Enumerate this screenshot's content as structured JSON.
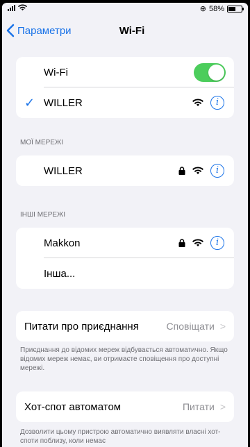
{
  "status_bar": {
    "battery_text": "58%",
    "battery_level": 0.58
  },
  "nav": {
    "back_label": "Параметри",
    "title": "Wi-Fi"
  },
  "wifi_group": {
    "toggle_label": "Wi-Fi",
    "toggle_on": true,
    "connected_network": "WILLER"
  },
  "my_networks": {
    "header": "МОЇ МЕРЕЖІ",
    "items": [
      {
        "name": "WILLER",
        "locked": true
      }
    ]
  },
  "other_networks": {
    "header": "ІНШІ МЕРЕЖІ",
    "items": [
      {
        "name": "Makkon",
        "locked": true
      }
    ],
    "other_label": "Інша..."
  },
  "ask_to_join": {
    "label": "Питати про приєднання",
    "value": "Сповіщати",
    "footnote": "Приєднання до відомих мереж відбувається автоматично. Якщо відомих мереж немає, ви отримаєте сповіщення про доступні мережі."
  },
  "auto_hotspot": {
    "label": "Хот-спот автоматом",
    "value": "Питати",
    "footnote": "Дозволити цьому пристрою автоматично виявляти власні хот-споти поблизу, коли немає"
  },
  "colors": {
    "accent": "#1a73e8",
    "toggle_on": "#4ccd5c",
    "background": "#f2f2f7"
  }
}
